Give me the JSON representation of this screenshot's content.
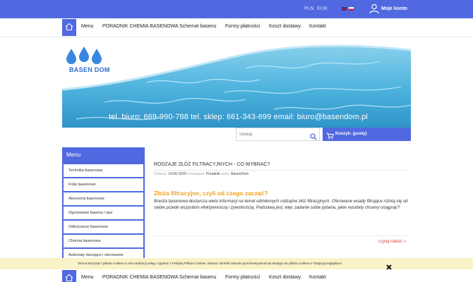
{
  "topbar": {
    "currency_pln": "PLN",
    "currency_eur": "EUR",
    "account_label": "Moje konto"
  },
  "nav": {
    "items": [
      "Menu",
      "PORADNIK CHEMIA BASENOWA",
      "Schemat basenu",
      "Formy płatności",
      "Koszt dostawy",
      "Kontakt"
    ]
  },
  "banner": {
    "logo_text": "BASEN DOM",
    "contact": "tel. biuro: 669-990-788   tel. sklep: 661-343-699   email: biuro@basendom.pl"
  },
  "search": {
    "placeholder": "Szukaj"
  },
  "cart": {
    "label": "Koszyk: (pusty)"
  },
  "sidebar": {
    "title": "Menu",
    "items": [
      "Technika basenowa",
      "Folie basenowe",
      "Akcesoria basenowe",
      "Ogrzewanie basenu i spa",
      "Odkurzacze basenowe",
      "Chemia basenowa",
      "Automaty dozujące i sterowanie"
    ]
  },
  "post": {
    "title": "RODZAJE ZŁÓŻ FILTRACYJNYCH - CO WYBRAĆ?",
    "meta_added_label": "Dodano:",
    "meta_date": "14-05-2020",
    "meta_category_label": "w kategorii:",
    "meta_category": "Poradnik",
    "meta_author_label": "autor:",
    "meta_author": "BasenDom",
    "heading": "Złoża filtracyjne, czyli od czego zacząć?",
    "body": "Branża basenowa dostarcza wielu informacji na temat odmiennych rodzajów złóż filtracyjnych. Oferowane wsady filtrujące różnią się od siebie przede wszystkim efektywnością i żywotnością. Podstawą jest, więc zadanie sobie pytania, jakie rezultaty chcemy osiągnąć?",
    "read_more": "czytaj całość »"
  },
  "cookie": {
    "text": "Strona korzysta z plików cookies w celu realizacji usług i zgodnie z Polityką Plików Cookies. Możesz określić warunki przechowywania lub dostępu do plików cookies w Twojej przeglądarce."
  },
  "colors": {
    "accent": "#5068e0",
    "heading": "#f0a020",
    "read_more": "#e04040",
    "cookie_bg": "#faf2c8"
  }
}
